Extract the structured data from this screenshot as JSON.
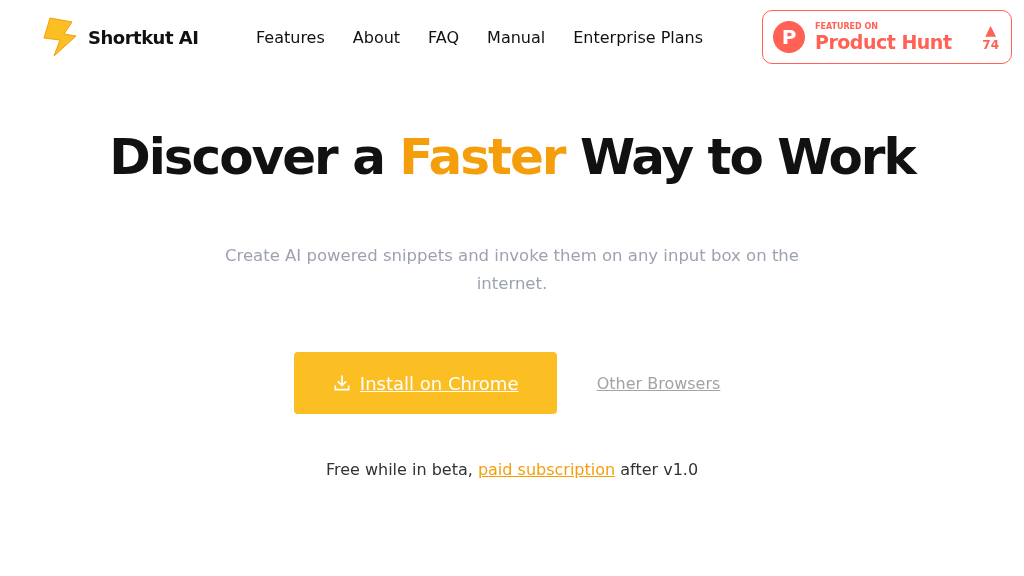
{
  "brand": {
    "name": "Shortkut AI"
  },
  "nav": [
    "Features",
    "About",
    "FAQ",
    "Manual",
    "Enterprise Plans"
  ],
  "product_hunt": {
    "caption": "FEATURED ON",
    "name": "Product Hunt",
    "logo_letter": "P",
    "arrow": "▲",
    "votes": "74"
  },
  "headline": {
    "before": "Discover a ",
    "highlight": "Faster",
    "after": " Way to Work"
  },
  "subtitle": "Create AI powered snippets and invoke them on any input box on the internet.",
  "install_button": "Install on Chrome",
  "other_link": "Other Browsers",
  "note": {
    "before": "Free while in beta, ",
    "link": "paid subscription",
    "after": " after v1.0"
  }
}
